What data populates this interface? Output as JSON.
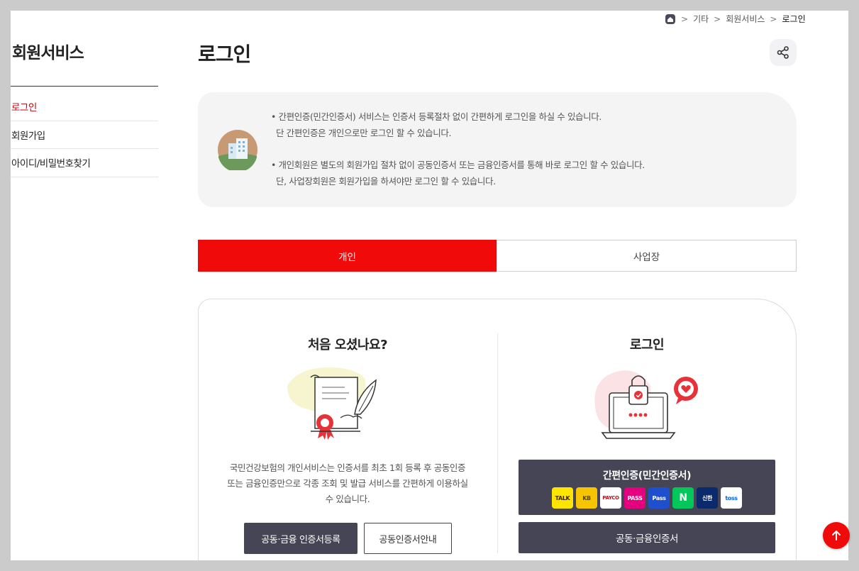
{
  "breadcrumb": {
    "home_icon": "home-icon",
    "items": [
      "기타",
      "회원서비스",
      "로그인"
    ]
  },
  "sidebar": {
    "title": "회원서비스",
    "items": [
      {
        "label": "로그인",
        "active": true
      },
      {
        "label": "회원가입",
        "active": false
      },
      {
        "label": "아이디/비밀번호찾기",
        "active": false
      }
    ]
  },
  "main": {
    "title": "로그인",
    "share_icon": "share-icon"
  },
  "info": {
    "illustration_icon": "building-icon",
    "lines": [
      "• 간편인증(민간인증서) 서비스는 인증서 등록절차 없이 간편하게 로그인을 하실 수 있습니다.",
      "단 간편인증은 개인으로만 로그인 할 수 있습니다.",
      "• 개인회원은 별도의 회원가입 절차 없이 공동인증서 또는 금융인증서를 통해 바로 로그인 할 수 있습니다.",
      "단, 사업장회원은 회원가입을 하셔야만 로그인 할 수 있습니다."
    ]
  },
  "tabs": [
    {
      "label": "개인",
      "active": true
    },
    {
      "label": "사업장",
      "active": false
    }
  ],
  "left": {
    "title": "처음 오셨나요?",
    "illustration_icon": "certificate-icon",
    "desc": [
      "국민건강보험의 개인서비스는 인증서를 최초 1회 등록 후 공동인증",
      "또는 금융인증만으로 각종 조회 및 발급 서비스를 간편하게 이용하실",
      "수 있습니다."
    ],
    "register_button": "공동·금융 인증서등록",
    "guide_button": "공동인증서안내"
  },
  "right": {
    "title": "로그인",
    "illustration_icon": "laptop-lock-icon",
    "simple_auth_button": "간편인증(민간인증서)",
    "providers": [
      {
        "label": "TALK",
        "bg": "#fee500",
        "fg": "#3a1d1d"
      },
      {
        "label": "KB",
        "bg": "#f7c400",
        "fg": "#5a4a00"
      },
      {
        "label": "PAYCO",
        "bg": "#ffffff",
        "fg": "#e60012"
      },
      {
        "label": "PASS",
        "bg": "#e5007e",
        "fg": "#ffffff"
      },
      {
        "label": "Pass",
        "bg": "#1d4fcf",
        "fg": "#ffffff"
      },
      {
        "label": "N",
        "bg": "#03c75a",
        "fg": "#ffffff"
      },
      {
        "label": "신한",
        "bg": "#0a2a6b",
        "fg": "#ffffff"
      },
      {
        "label": "toss",
        "bg": "#ffffff",
        "fg": "#0064ff"
      }
    ],
    "joint_cert_button": "공동·금융인증서"
  },
  "colors": {
    "accent_red": "#f00a0a",
    "dark_button": "#454556",
    "active_sidebar": "#c4000f"
  },
  "scroll_top_icon": "arrow-up-icon"
}
